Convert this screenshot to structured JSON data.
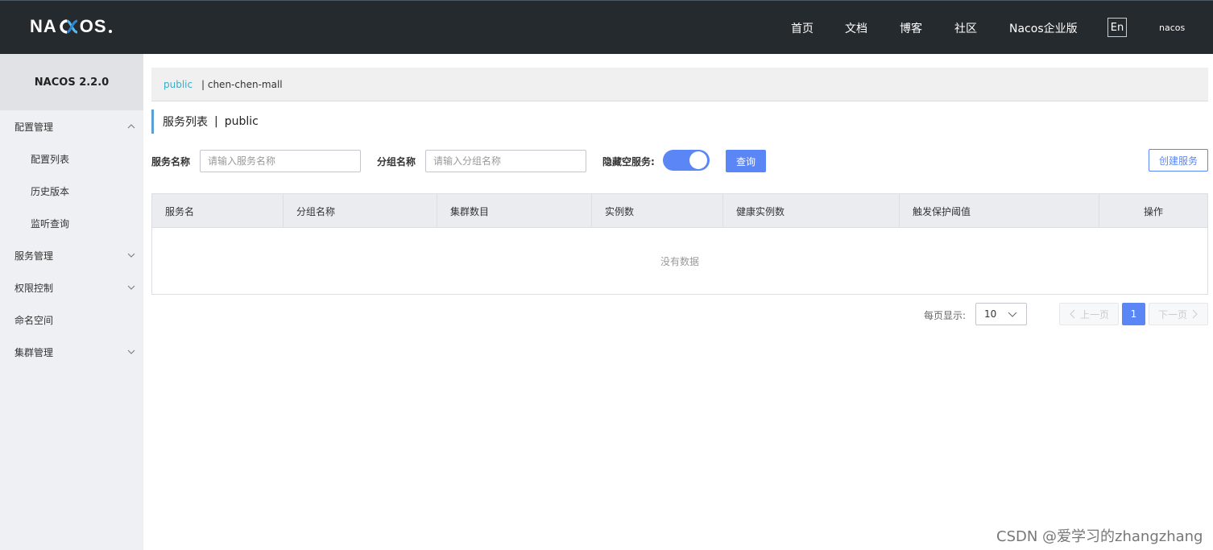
{
  "header": {
    "logo_text_left": "NA",
    "logo_text_right": "OS",
    "nav": [
      "首页",
      "文档",
      "博客",
      "社区",
      "Nacos企业版"
    ],
    "lang": "En",
    "user": "nacos"
  },
  "sidebar": {
    "version": "NACOS 2.2.0",
    "items": [
      {
        "label": "配置管理",
        "expanded": true
      },
      {
        "label": "配置列表",
        "sub": true
      },
      {
        "label": "历史版本",
        "sub": true
      },
      {
        "label": "监听查询",
        "sub": true
      },
      {
        "label": "服务管理",
        "expanded": false
      },
      {
        "label": "权限控制",
        "expanded": false
      },
      {
        "label": "命名空间"
      },
      {
        "label": "集群管理",
        "expanded": false
      }
    ]
  },
  "breadcrumb": {
    "namespace": "public",
    "separator": "| chen-chen-mall"
  },
  "page": {
    "title": "服务列表",
    "title_sep": "|",
    "title_ns": "public"
  },
  "filters": {
    "service_name_label": "服务名称",
    "service_name_placeholder": "请输入服务名称",
    "group_name_label": "分组名称",
    "group_name_placeholder": "请输入分组名称",
    "hide_empty_label": "隐藏空服务:",
    "hide_empty_on": true,
    "query_button": "查询",
    "create_button": "创建服务"
  },
  "table": {
    "columns": [
      "服务名",
      "分组名称",
      "集群数目",
      "实例数",
      "健康实例数",
      "触发保护阈值",
      "操作"
    ],
    "empty_text": "没有数据"
  },
  "pagination": {
    "page_size_label": "每页显示:",
    "page_size": "10",
    "prev": "上一页",
    "current": "1",
    "next": "下一页"
  },
  "watermark": "CSDN @爱学习的zhangzhang",
  "colors": {
    "topbar": "#252a2f",
    "primary": "#5b86f5",
    "link": "#3fa9c5",
    "sidebar_bg": "#eef0f3"
  }
}
